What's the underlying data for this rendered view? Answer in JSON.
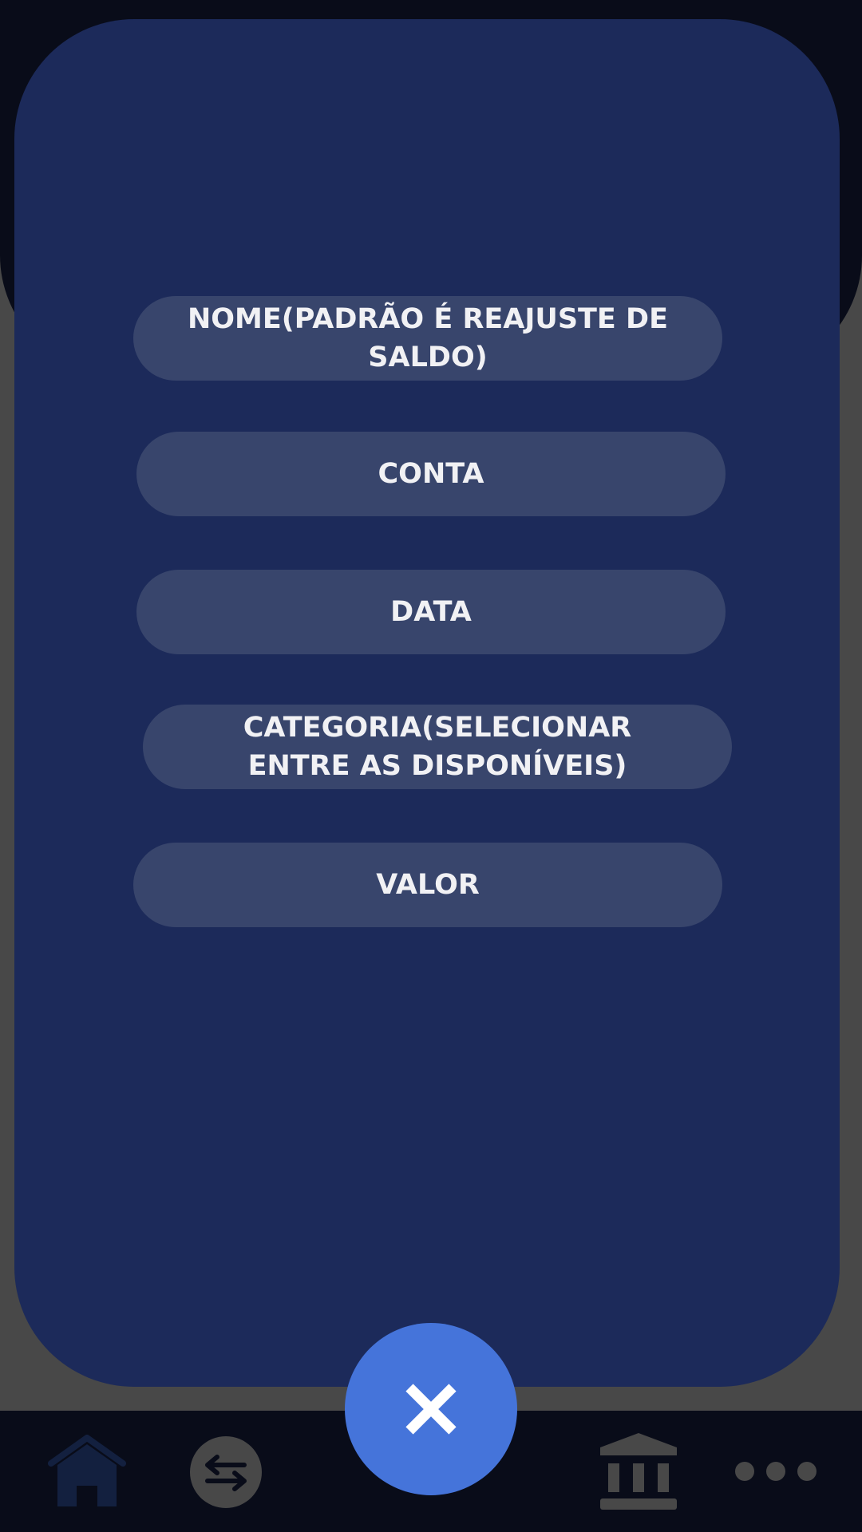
{
  "form": {
    "fields": [
      {
        "label": "NOME(PADRÃO É REAJUSTE DE SALDO)"
      },
      {
        "label": "CONTA"
      },
      {
        "label": "DATA"
      },
      {
        "label": "CATEGORIA(SELECIONAR ENTRE AS DISPONÍVEIS)"
      },
      {
        "label": "VALOR"
      }
    ]
  },
  "nav": {
    "items": [
      {
        "icon": "home-icon"
      },
      {
        "icon": "transfer-icon"
      },
      {
        "icon": "bank-icon"
      },
      {
        "icon": "more-icon"
      }
    ]
  },
  "fab": {
    "icon": "close-icon"
  },
  "colors": {
    "background": "#484848",
    "header": "#090c19",
    "modal": "#1c2a5a",
    "field": "#38456c",
    "fab": "#4574da",
    "nav_icon": "#484848"
  }
}
